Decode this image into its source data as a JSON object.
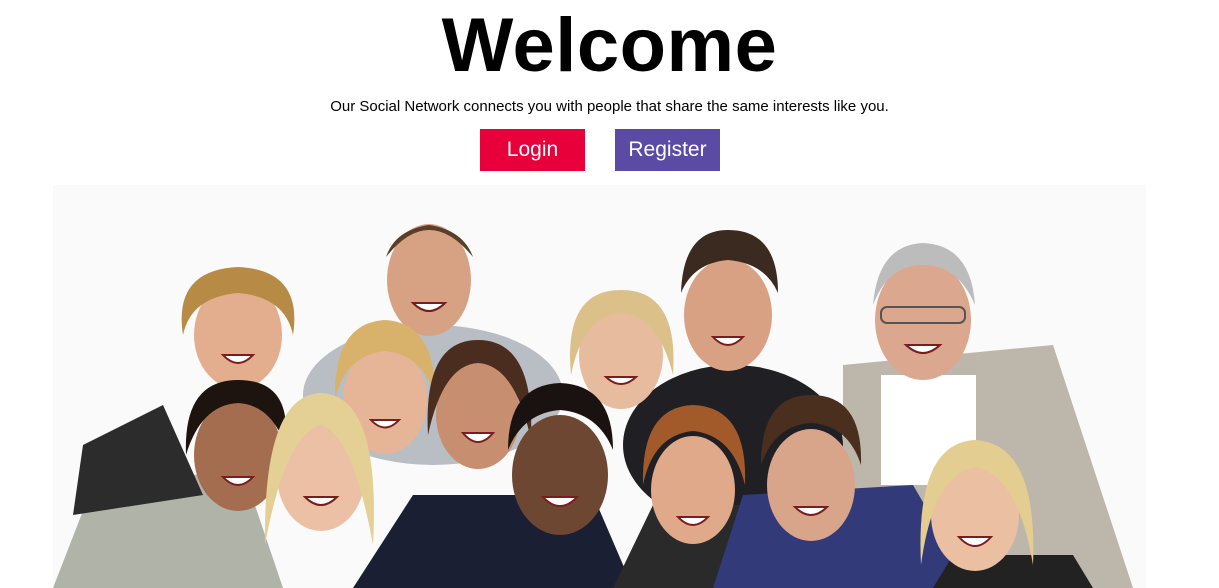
{
  "hero": {
    "title": "Welcome",
    "subtitle": "Our Social Network connects you with people that share the same interests like you."
  },
  "actions": {
    "login_label": "Login",
    "register_label": "Register"
  },
  "colors": {
    "login_bg": "#e8003a",
    "register_bg": "#5c4ba5",
    "text": "#000000",
    "background": "#ffffff"
  },
  "image": {
    "subject": "group-photo"
  }
}
